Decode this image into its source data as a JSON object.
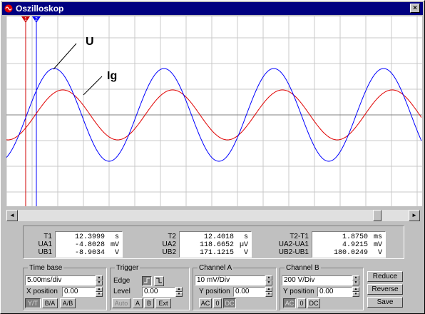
{
  "window": {
    "title": "Oszilloskop",
    "close_glyph": "×",
    "title_icon": "oscilloscope-app-icon"
  },
  "screen": {
    "annotations": [
      {
        "text": "U"
      },
      {
        "text": "Ig"
      }
    ],
    "markers": [
      {
        "label": "1",
        "color": "#d00000"
      },
      {
        "label": "2",
        "color": "#0000ff"
      }
    ],
    "colors": {
      "channel_a": "#0000ff",
      "channel_b": "#e00000",
      "grid": "#c8c8c8",
      "axis": "#808080"
    }
  },
  "scrollbar": {
    "left_glyph": "◄",
    "right_glyph": "►"
  },
  "readout": {
    "t1": {
      "labels": [
        "T1",
        "UA1",
        "UB1"
      ],
      "values": [
        "12.3999",
        "-4.8028",
        "-8.9034"
      ],
      "units": [
        "s",
        "mV",
        "V"
      ]
    },
    "t2": {
      "labels": [
        "T2",
        "UA2",
        "UB2"
      ],
      "values": [
        "12.4018",
        "118.6652",
        "171.1215"
      ],
      "units": [
        "s",
        "µV",
        "V"
      ]
    },
    "diff": {
      "labels": [
        "T2-T1",
        "UA2-UA1",
        "UB2-UB1"
      ],
      "values": [
        "1.8750",
        "4.9215",
        "180.0249"
      ],
      "units": [
        "ms",
        "mV",
        "V"
      ]
    }
  },
  "timebase": {
    "legend": "Time base",
    "value": "5.00ms/div",
    "xpos_label": "X position",
    "xpos_value": "0.00",
    "modes": [
      "Y/T",
      "B/A",
      "A/B"
    ]
  },
  "trigger": {
    "legend": "Trigger",
    "edge_label": "Edge",
    "level_label": "Level",
    "level_value": "0.00",
    "sources": [
      "Auto",
      "A",
      "B",
      "Ext"
    ]
  },
  "channel_a": {
    "legend": "Channel A",
    "value": "10 mV/Div",
    "ypos_label": "Y position",
    "ypos_value": "0.00",
    "coupling": [
      "AC",
      "0",
      "DC"
    ]
  },
  "channel_b": {
    "legend": "Channel B",
    "value": "200 V/Div",
    "ypos_label": "Y position",
    "ypos_value": "0.00",
    "coupling": [
      "AC",
      "0",
      "DC"
    ]
  },
  "buttons": {
    "reduce": "Reduce",
    "reverse": "Reverse",
    "save": "Save"
  }
}
